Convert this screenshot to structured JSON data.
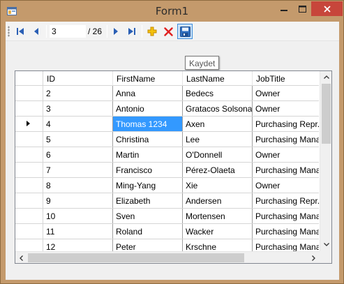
{
  "window": {
    "title": "Form1",
    "colors": {
      "frame": "#c49a6c",
      "close_button": "#c7463b"
    }
  },
  "navigator": {
    "buttons": {
      "move_first": "move-first-icon",
      "move_previous": "move-previous-icon",
      "move_next": "move-next-icon",
      "move_last": "move-last-icon",
      "add_new": "add-icon",
      "delete": "delete-icon",
      "save": "save-icon"
    },
    "position": "3",
    "count": "/ 26",
    "tooltip": "Kaydet"
  },
  "grid": {
    "columns": [
      "ID",
      "FirstName",
      "LastName",
      "JobTitle"
    ],
    "current_row_index": 2,
    "selected_cell": {
      "row": 2,
      "column": "FirstName"
    },
    "rows": [
      {
        "id": "2",
        "first": "Anna",
        "last": "Bedecs",
        "job": "Owner"
      },
      {
        "id": "3",
        "first": "Antonio",
        "last": "Gratacos Solsona",
        "job": "Owner"
      },
      {
        "id": "4",
        "first": "Thomas 1234",
        "last": "Axen",
        "job": "Purchasing Repr..."
      },
      {
        "id": "5",
        "first": "Christina",
        "last": "Lee",
        "job": "Purchasing Mana..."
      },
      {
        "id": "6",
        "first": "Martin",
        "last": "O'Donnell",
        "job": "Owner"
      },
      {
        "id": "7",
        "first": "Francisco",
        "last": "Pérez-Olaeta",
        "job": "Purchasing Mana..."
      },
      {
        "id": "8",
        "first": "Ming-Yang",
        "last": "Xie",
        "job": "Owner"
      },
      {
        "id": "9",
        "first": "Elizabeth",
        "last": "Andersen",
        "job": "Purchasing Repr..."
      },
      {
        "id": "10",
        "first": "Sven",
        "last": "Mortensen",
        "job": "Purchasing Mana..."
      },
      {
        "id": "11",
        "first": "Roland",
        "last": "Wacker",
        "job": "Purchasing Mana..."
      },
      {
        "id": "12",
        "first": "Peter",
        "last": "Krschne",
        "job": "Purchasing Mana..."
      }
    ],
    "selection_color": "#3399ff"
  }
}
